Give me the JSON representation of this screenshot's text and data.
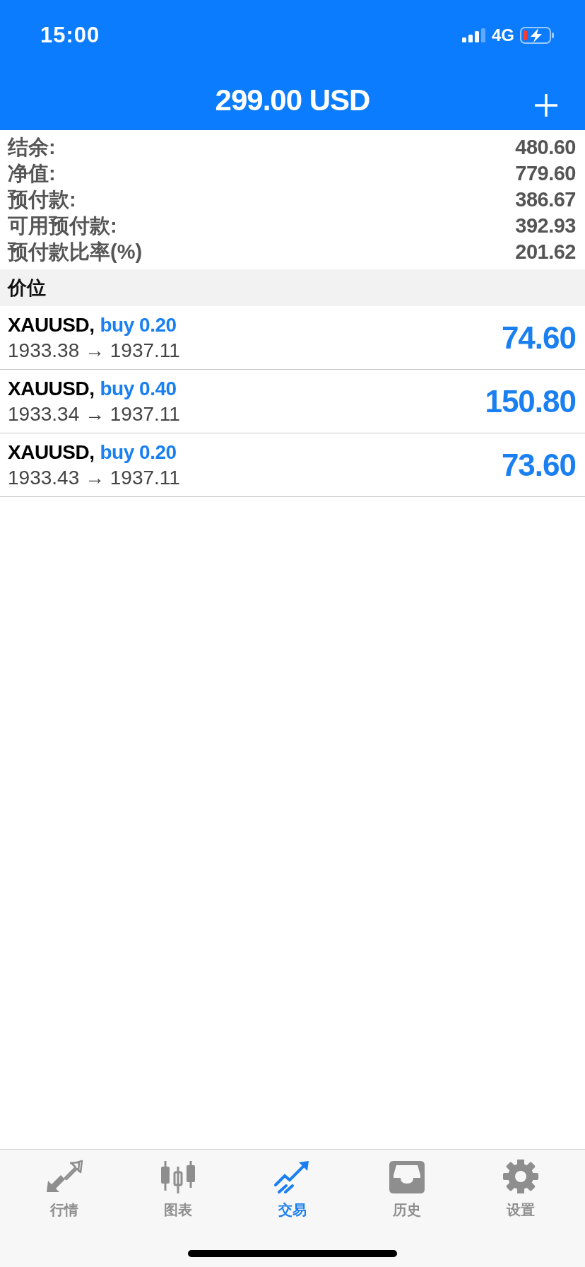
{
  "status_bar": {
    "time": "15:00",
    "network": "4G"
  },
  "header": {
    "title": "299.00 USD"
  },
  "summary": [
    {
      "label": "结余:",
      "value": "480.60"
    },
    {
      "label": "净值:",
      "value": "779.60"
    },
    {
      "label": "预付款:",
      "value": "386.67"
    },
    {
      "label": "可用预付款:",
      "value": "392.93"
    },
    {
      "label": "预付款比率(%)",
      "value": "201.62"
    }
  ],
  "section_title": "价位",
  "positions": [
    {
      "symbol": "XAUUSD,",
      "order": "buy 0.20",
      "prices": "1933.38 → 1937.11",
      "profit": "74.60"
    },
    {
      "symbol": "XAUUSD,",
      "order": "buy 0.40",
      "prices": "1933.34 → 1937.11",
      "profit": "150.80"
    },
    {
      "symbol": "XAUUSD,",
      "order": "buy 0.20",
      "prices": "1933.43 → 1937.11",
      "profit": "73.60"
    }
  ],
  "tabs": [
    {
      "label": "行情",
      "selected": false
    },
    {
      "label": "图表",
      "selected": false
    },
    {
      "label": "交易",
      "selected": true
    },
    {
      "label": "历史",
      "selected": false
    },
    {
      "label": "设置",
      "selected": false
    }
  ]
}
